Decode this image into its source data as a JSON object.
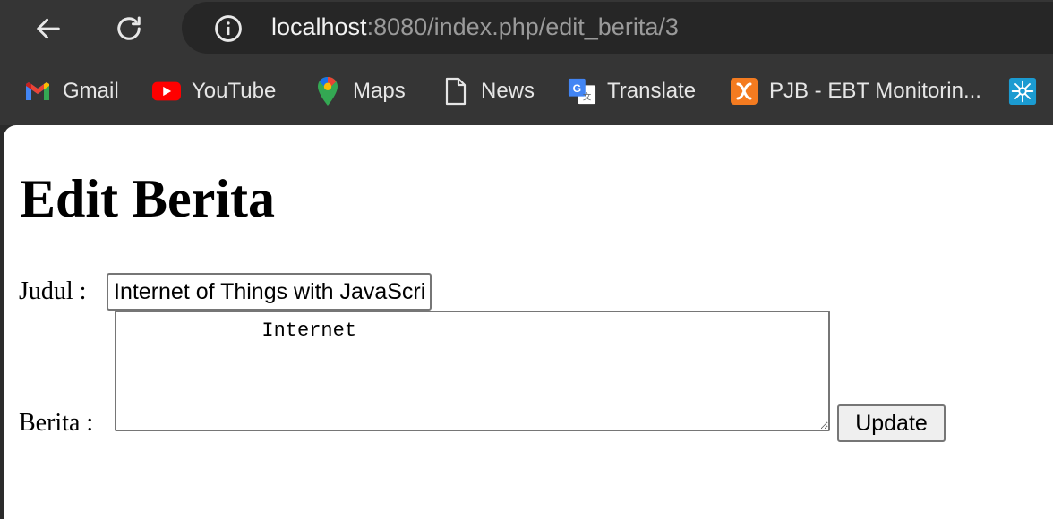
{
  "browser": {
    "url_host": "localhost",
    "url_path": ":8080/index.php/edit_berita/3",
    "icons": {
      "back": "back-arrow-icon",
      "reload": "reload-icon",
      "info": "info-icon"
    },
    "bookmarks": [
      {
        "label": "Gmail",
        "icon": "gmail-icon",
        "color": "#EA4335"
      },
      {
        "label": "YouTube",
        "icon": "youtube-icon",
        "color": "#FF0000"
      },
      {
        "label": "Maps",
        "icon": "maps-icon",
        "color": "#34A853"
      },
      {
        "label": "News",
        "icon": "document-icon",
        "color": "#E6E6E6"
      },
      {
        "label": "Translate",
        "icon": "translate-icon",
        "color": "#4285F4"
      },
      {
        "label": "PJB - EBT Monitorin...",
        "icon": "xampp-icon",
        "color": "#F47B20"
      }
    ]
  },
  "page": {
    "heading": "Edit Berita",
    "judul_label": "Judul :",
    "judul_value": "Internet of Things with JavaScript",
    "berita_label": "Berita :",
    "berita_value": "            Internet",
    "update_button": "Update"
  },
  "colors": {
    "chrome_bg": "#353535",
    "omnibox_bg": "#262626",
    "page_bg": "#ffffff"
  }
}
